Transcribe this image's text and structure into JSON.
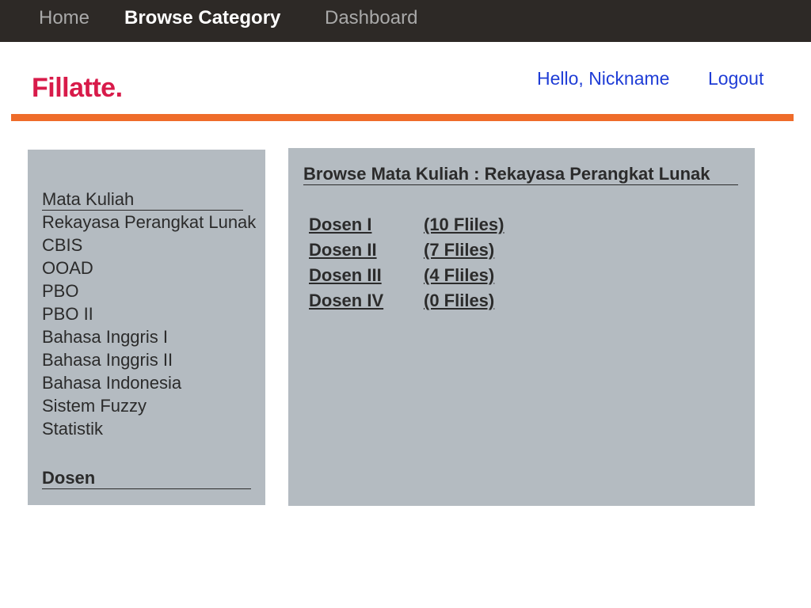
{
  "nav": {
    "home": "Home",
    "browse": "Browse Category",
    "dashboard": "Dashboard"
  },
  "header": {
    "logo": "Fillatte.",
    "greeting": "Hello, Nickname",
    "logout": "Logout"
  },
  "sidebar": {
    "mata_kuliah_heading": "Mata Kuliah",
    "items": [
      "Rekayasa Perangkat Lunak",
      "CBIS",
      "OOAD",
      "PBO",
      "PBO II",
      "Bahasa Inggris I",
      "Bahasa Inggris II",
      "Bahasa Indonesia",
      "Sistem Fuzzy",
      "Statistik"
    ],
    "dosen_heading": "Dosen"
  },
  "main": {
    "title": "Browse Mata Kuliah : Rekayasa Perangkat Lunak",
    "dosen": [
      {
        "name": "Dosen I",
        "files": "(10 Fliles)"
      },
      {
        "name": "Dosen II",
        "files": "(7 Fliles)"
      },
      {
        "name": "Dosen III",
        "files": "(4 Fliles)"
      },
      {
        "name": "Dosen IV",
        "files": "(0 Fliles)"
      }
    ]
  },
  "colors": {
    "nav_bg": "#2d2926",
    "logo": "#d81b4a",
    "link": "#1f3dd6",
    "accent_bar": "#ef6c2a",
    "panel_bg": "#b4bbc1"
  }
}
